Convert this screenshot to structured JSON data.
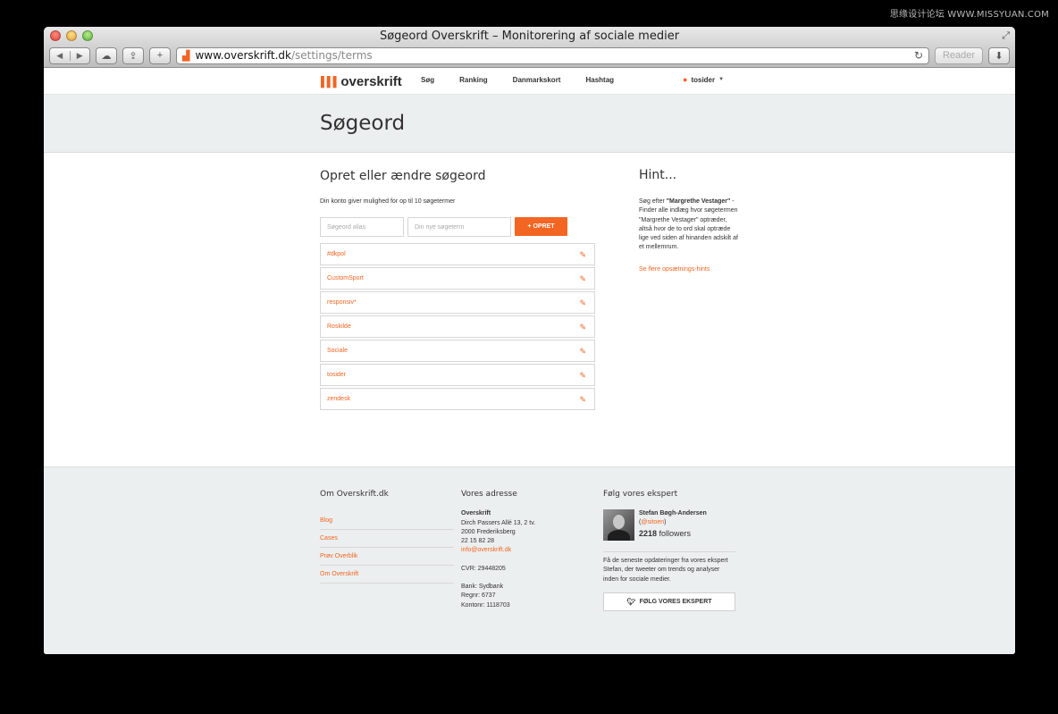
{
  "watermark": "思缘设计论坛 WWW.MISSYUAN.COM",
  "window": {
    "title": "Søgeord Overskrift – Monitorering af sociale medier",
    "url_host": "www.overskrift.dk",
    "url_path": "/settings/terms",
    "reader_label": "Reader"
  },
  "nav": {
    "logo": "overskrift",
    "links": [
      "Søg",
      "Ranking",
      "Danmarkskort",
      "Hashtag"
    ],
    "user": "tosider"
  },
  "hero": {
    "title": "Søgeord"
  },
  "main": {
    "heading": "Opret eller ændre søgeord",
    "limit_text": "Din konto giver mulighed for op til 10 søgetermer",
    "alias_placeholder": "Søgeord alias",
    "term_placeholder": "Din nye søgeterm",
    "create_button": "+ OPRET",
    "terms": [
      "#dkpol",
      "CustomSport",
      "responsiv*",
      "Roskilde",
      "Sociale",
      "tosider",
      "zendesk"
    ]
  },
  "hint": {
    "title": "Hint...",
    "body_prefix": "Søg efter ",
    "body_bold": "\"Margrethe Vestager\"",
    "body_suffix": " - Finder alle indlæg hvor søgetermen \"Margrethe Vestager\" optræder, altså hvor de to ord skal optræde lige ved siden af hinanden adskilt af et mellemrum.",
    "link": "Se flere opsætnings-hints"
  },
  "footer": {
    "col1_title": "Om Overskrift.dk",
    "links": [
      "Blog",
      "Cases",
      "Prøv Overblik",
      "Om Overskrift"
    ],
    "col2_title": "Vores adresse",
    "company": "Overskrift",
    "street": "Dirch Passers Allé 13, 2 tv.",
    "city": "2000 Frederiksberg",
    "phone": "22 15 82 28",
    "email": "info@overskrift.dk",
    "cvr": "CVR: 29448205",
    "bank": "Bank: Sydbank",
    "regnr": "Regnr: 6737",
    "konto": "Kontonr: 1118703",
    "col3_title": "Følg vores ekspert",
    "expert_name": "Stefan Bøgh-Andersen",
    "expert_handle": "@sitoen",
    "followers_count": "2218",
    "followers_label": " followers",
    "expert_desc": "Få de seneste opdateringer fra vores ekspert Stefan, der tweeter om trends og analyser inden for sociale medier.",
    "follow_button": "FØLG VORES EKSPERT"
  }
}
